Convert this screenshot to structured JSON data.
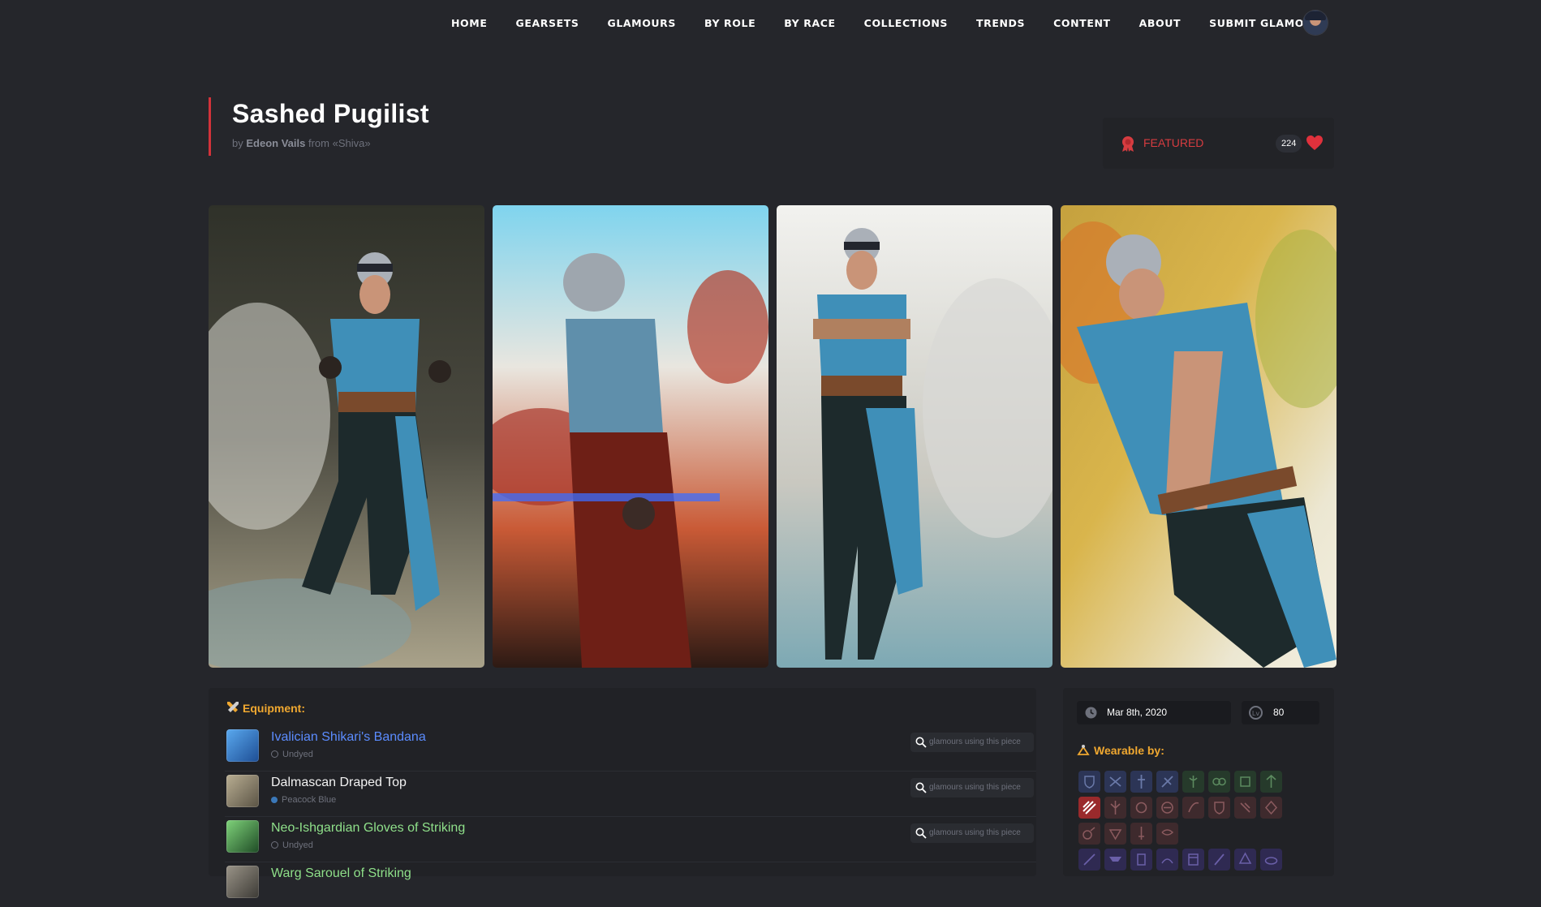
{
  "nav": {
    "items": [
      "HOME",
      "GEARSETS",
      "GLAMOURS",
      "BY ROLE",
      "BY RACE",
      "COLLECTIONS",
      "TRENDS",
      "CONTENT",
      "ABOUT",
      "SUBMIT GLAMOUR"
    ],
    "avatar_icon": "user-avatar"
  },
  "glamour": {
    "title": "Sashed Pugilist",
    "by_label": "by",
    "author": "Edeon Vails",
    "from_label": "from",
    "server": "«Shiva»"
  },
  "featured": {
    "label": "FEATURED",
    "likes": "224",
    "accent": "#d63c40"
  },
  "gallery": {
    "photos": [
      "Screenshot 1",
      "Screenshot 2",
      "Screenshot 3",
      "Screenshot 4"
    ]
  },
  "equipment": {
    "heading": "Equipment:",
    "search_label": "glamours using this piece",
    "items": [
      {
        "name": "Ivalician Shikari's Bandana",
        "dye": "Undyed",
        "name_color": "#5b8cff",
        "dye_color": ""
      },
      {
        "name": "Dalmascan Draped Top",
        "dye": "Peacock Blue",
        "name_color": "#f2f2f2",
        "dye_color": "#3b78b8"
      },
      {
        "name": "Neo-Ishgardian Gloves of Striking",
        "dye": "Undyed",
        "name_color": "#8fe08a",
        "dye_color": ""
      },
      {
        "name": "Warg Sarouel of Striking",
        "dye": "",
        "name_color": "#8fe08a",
        "dye_color": ""
      }
    ]
  },
  "info": {
    "date": "Mar 8th, 2020",
    "level": "80",
    "wearable_heading": "Wearable by:"
  },
  "colors": {
    "tank": "#2c3556",
    "healer": "#263a2b",
    "dps": "#3e2a2d",
    "active": "#9a2a2c",
    "gatherer": "#2f2a52"
  }
}
